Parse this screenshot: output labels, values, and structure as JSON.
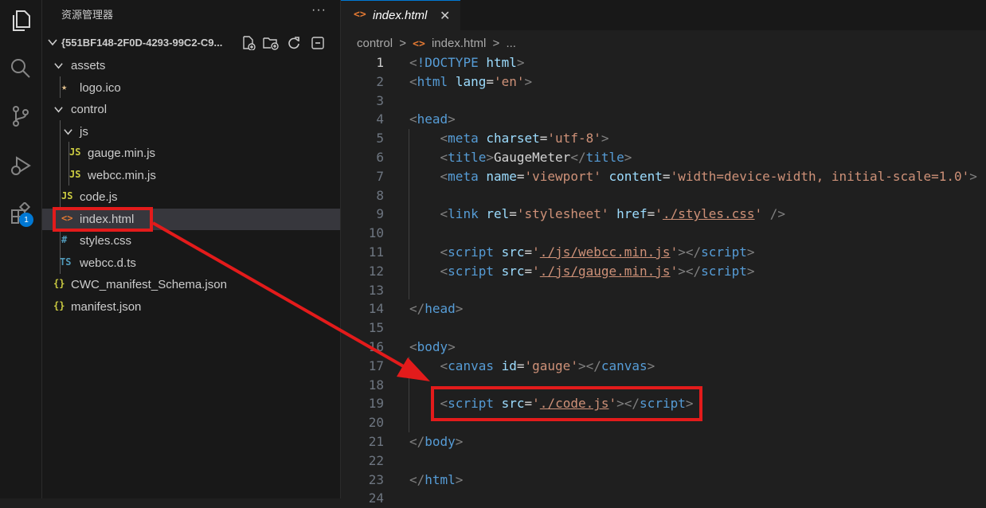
{
  "explorer": {
    "title": "资源管理器",
    "more": "···",
    "root_folder": "{551BF148-2F0D-4293-99C2-C9...",
    "toolbar": [
      "new-file-icon",
      "new-folder-icon",
      "refresh-icon",
      "collapse-all-icon"
    ],
    "tree": [
      {
        "label": "assets",
        "kind": "folder",
        "icon": "chevron-down-icon"
      },
      {
        "label": "logo.ico",
        "kind": "file",
        "icon_text": "★",
        "icon": "star-file-icon",
        "color": "#e2c08d"
      },
      {
        "label": "control",
        "kind": "folder",
        "icon": "chevron-down-icon"
      },
      {
        "label": "js",
        "kind": "folder",
        "icon": "chevron-down-icon"
      },
      {
        "label": "gauge.min.js",
        "kind": "file",
        "icon_text": "JS",
        "icon": "js-file-icon",
        "color": "#cbcb41"
      },
      {
        "label": "webcc.min.js",
        "kind": "file",
        "icon_text": "JS",
        "icon": "js-file-icon",
        "color": "#cbcb41"
      },
      {
        "label": "code.js",
        "kind": "file",
        "icon_text": "JS",
        "icon": "js-file-icon",
        "color": "#cbcb41"
      },
      {
        "label": "index.html",
        "kind": "file",
        "icon_text": "<>",
        "icon": "html-file-icon",
        "color": "#e37933"
      },
      {
        "label": "styles.css",
        "kind": "file",
        "icon_text": "#",
        "icon": "css-file-icon",
        "color": "#519aba"
      },
      {
        "label": "webcc.d.ts",
        "kind": "file",
        "icon_text": "TS",
        "icon": "ts-file-icon",
        "color": "#519aba"
      },
      {
        "label": "CWC_manifest_Schema.json",
        "kind": "file",
        "icon_text": "{}",
        "icon": "json-file-icon",
        "color": "#cbcb41"
      },
      {
        "label": "manifest.json",
        "kind": "file",
        "icon_text": "{}",
        "icon": "json-file-icon",
        "color": "#cbcb41"
      }
    ]
  },
  "activity_bar": {
    "icons": [
      "explorer-icon",
      "search-icon",
      "source-control-icon",
      "run-debug-icon",
      "extensions-icon"
    ],
    "extensions_badge": "1"
  },
  "editor": {
    "tab_label": "index.html",
    "tab_icon_text": "<>",
    "tab_close": "✕",
    "breadcrumb": [
      "control",
      ">",
      "<>",
      "index.html",
      ">",
      "..."
    ],
    "code_lines": [
      {
        "n": "1",
        "tokens": [
          [
            "b",
            "<"
          ],
          [
            "tag",
            "!DOCTYPE "
          ],
          [
            "attr",
            "html"
          ],
          [
            "b",
            ">"
          ]
        ]
      },
      {
        "n": "2",
        "tokens": [
          [
            "b",
            "<"
          ],
          [
            "tag",
            "html "
          ],
          [
            "attr",
            "lang"
          ],
          [
            "txt",
            "="
          ],
          [
            "str",
            "'en'"
          ],
          [
            "b",
            ">"
          ]
        ]
      },
      {
        "n": "3",
        "tokens": []
      },
      {
        "n": "4",
        "tokens": [
          [
            "b",
            "<"
          ],
          [
            "tag",
            "head"
          ],
          [
            "b",
            ">"
          ]
        ]
      },
      {
        "n": "5",
        "tokens": [
          [
            "txt",
            "    "
          ],
          [
            "b",
            "<"
          ],
          [
            "tag",
            "meta "
          ],
          [
            "attr",
            "charset"
          ],
          [
            "txt",
            "="
          ],
          [
            "str",
            "'utf-8'"
          ],
          [
            "b",
            ">"
          ]
        ]
      },
      {
        "n": "6",
        "tokens": [
          [
            "txt",
            "    "
          ],
          [
            "b",
            "<"
          ],
          [
            "tag",
            "title"
          ],
          [
            "b",
            ">"
          ],
          [
            "txt",
            "GaugeMeter"
          ],
          [
            "b",
            "</"
          ],
          [
            "tag",
            "title"
          ],
          [
            "b",
            ">"
          ]
        ]
      },
      {
        "n": "7",
        "tokens": [
          [
            "txt",
            "    "
          ],
          [
            "b",
            "<"
          ],
          [
            "tag",
            "meta "
          ],
          [
            "attr",
            "name"
          ],
          [
            "txt",
            "="
          ],
          [
            "str",
            "'viewport' "
          ],
          [
            "attr",
            "content"
          ],
          [
            "txt",
            "="
          ],
          [
            "str",
            "'width=device-width, initial-scale=1.0'"
          ],
          [
            "b",
            ">"
          ]
        ]
      },
      {
        "n": "8",
        "tokens": []
      },
      {
        "n": "9",
        "tokens": [
          [
            "txt",
            "    "
          ],
          [
            "b",
            "<"
          ],
          [
            "tag",
            "link "
          ],
          [
            "attr",
            "rel"
          ],
          [
            "txt",
            "="
          ],
          [
            "str",
            "'stylesheet' "
          ],
          [
            "attr",
            "href"
          ],
          [
            "txt",
            "="
          ],
          [
            "str",
            "'"
          ],
          [
            "url",
            "./styles.css"
          ],
          [
            "str",
            "' "
          ],
          [
            "b",
            "/>"
          ]
        ]
      },
      {
        "n": "10",
        "tokens": []
      },
      {
        "n": "11",
        "tokens": [
          [
            "txt",
            "    "
          ],
          [
            "b",
            "<"
          ],
          [
            "tag",
            "script "
          ],
          [
            "attr",
            "src"
          ],
          [
            "txt",
            "="
          ],
          [
            "str",
            "'"
          ],
          [
            "url",
            "./js/webcc.min.js"
          ],
          [
            "str",
            "'"
          ],
          [
            "b",
            "></"
          ],
          [
            "tag",
            "script"
          ],
          [
            "b",
            ">"
          ]
        ]
      },
      {
        "n": "12",
        "tokens": [
          [
            "txt",
            "    "
          ],
          [
            "b",
            "<"
          ],
          [
            "tag",
            "script "
          ],
          [
            "attr",
            "src"
          ],
          [
            "txt",
            "="
          ],
          [
            "str",
            "'"
          ],
          [
            "url",
            "./js/gauge.min.js"
          ],
          [
            "str",
            "'"
          ],
          [
            "b",
            "></"
          ],
          [
            "tag",
            "script"
          ],
          [
            "b",
            ">"
          ]
        ]
      },
      {
        "n": "13",
        "tokens": []
      },
      {
        "n": "14",
        "tokens": [
          [
            "b",
            "</"
          ],
          [
            "tag",
            "head"
          ],
          [
            "b",
            ">"
          ]
        ]
      },
      {
        "n": "15",
        "tokens": []
      },
      {
        "n": "16",
        "tokens": [
          [
            "b",
            "<"
          ],
          [
            "tag",
            "body"
          ],
          [
            "b",
            ">"
          ]
        ]
      },
      {
        "n": "17",
        "tokens": [
          [
            "txt",
            "    "
          ],
          [
            "b",
            "<"
          ],
          [
            "tag",
            "canvas "
          ],
          [
            "attr",
            "id"
          ],
          [
            "txt",
            "="
          ],
          [
            "str",
            "'gauge'"
          ],
          [
            "b",
            "></"
          ],
          [
            "tag",
            "canvas"
          ],
          [
            "b",
            ">"
          ]
        ]
      },
      {
        "n": "18",
        "tokens": []
      },
      {
        "n": "19",
        "tokens": [
          [
            "txt",
            "    "
          ],
          [
            "b",
            "<"
          ],
          [
            "tag",
            "script "
          ],
          [
            "attr",
            "src"
          ],
          [
            "txt",
            "="
          ],
          [
            "str",
            "'"
          ],
          [
            "url",
            "./code.js"
          ],
          [
            "str",
            "'"
          ],
          [
            "b",
            "></"
          ],
          [
            "tag",
            "script"
          ],
          [
            "b",
            ">"
          ]
        ]
      },
      {
        "n": "20",
        "tokens": []
      },
      {
        "n": "21",
        "tokens": [
          [
            "b",
            "</"
          ],
          [
            "tag",
            "body"
          ],
          [
            "b",
            ">"
          ]
        ]
      },
      {
        "n": "22",
        "tokens": []
      },
      {
        "n": "23",
        "tokens": [
          [
            "b",
            "</"
          ],
          [
            "tag",
            "html"
          ],
          [
            "b",
            ">"
          ]
        ]
      },
      {
        "n": "24",
        "tokens": []
      }
    ]
  },
  "colors": {
    "annotation": "#e31b1b",
    "accent": "#0078d4"
  }
}
